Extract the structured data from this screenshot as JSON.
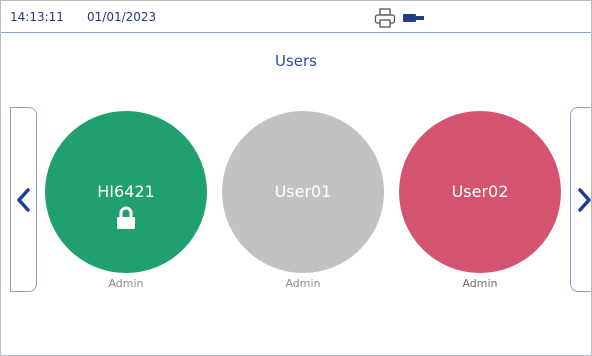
{
  "status_bar": {
    "time": "14:13:11",
    "date": "01/01/2023",
    "icons": [
      "printer-icon",
      "usb-icon"
    ]
  },
  "page": {
    "title": "Users"
  },
  "navigation": {
    "prev_icon": "chevron-left-icon",
    "next_icon": "chevron-right-icon"
  },
  "users": [
    {
      "name": "HI6421",
      "role": "Admin",
      "color": "#1fa06e",
      "locked": true
    },
    {
      "name": "User01",
      "role": "Admin",
      "color": "#c2c2c2",
      "locked": false
    },
    {
      "name": "User02",
      "role": "Admin",
      "color": "#d45470",
      "locked": false
    }
  ],
  "colors": {
    "accent": "#233a86",
    "border": "#8fa0cc"
  }
}
